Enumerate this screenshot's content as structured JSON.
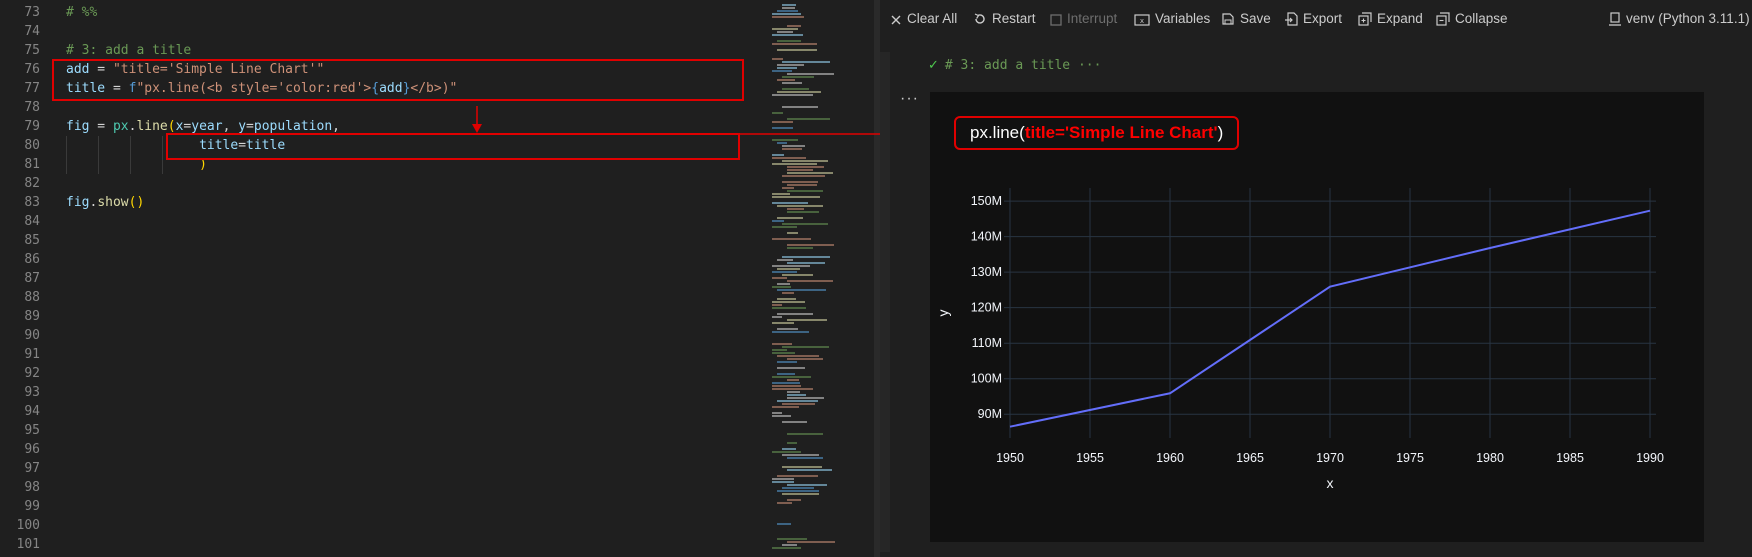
{
  "editor": {
    "lines": [
      {
        "num": "73",
        "tokens": [
          {
            "t": "# %%",
            "c": "comment"
          }
        ]
      },
      {
        "num": "74",
        "tokens": []
      },
      {
        "num": "75",
        "tokens": [
          {
            "t": "# 3: add a title",
            "c": "comment"
          }
        ]
      },
      {
        "num": "76",
        "tokens": [
          {
            "t": "add",
            "c": "var"
          },
          {
            "t": " = ",
            "c": "op"
          },
          {
            "t": "\"title='Simple Line Chart'\"",
            "c": "str"
          }
        ]
      },
      {
        "num": "77",
        "tokens": [
          {
            "t": "title",
            "c": "var"
          },
          {
            "t": " = ",
            "c": "op"
          },
          {
            "t": "f",
            "c": "kw"
          },
          {
            "t": "\"px.line(<b style='color:red'>",
            "c": "str"
          },
          {
            "t": "{",
            "c": "kw"
          },
          {
            "t": "add",
            "c": "var"
          },
          {
            "t": "}",
            "c": "kw"
          },
          {
            "t": "</b>)\"",
            "c": "str"
          }
        ]
      },
      {
        "num": "78",
        "tokens": []
      },
      {
        "num": "79",
        "tokens": [
          {
            "t": "fig",
            "c": "var"
          },
          {
            "t": " = ",
            "c": "op"
          },
          {
            "t": "px",
            "c": "ns"
          },
          {
            "t": ".",
            "c": "op"
          },
          {
            "t": "line",
            "c": "fn"
          },
          {
            "t": "(",
            "c": "br1"
          },
          {
            "t": "x",
            "c": "var"
          },
          {
            "t": "=",
            "c": "op"
          },
          {
            "t": "year",
            "c": "var"
          },
          {
            "t": ", ",
            "c": "op"
          },
          {
            "t": "y",
            "c": "var"
          },
          {
            "t": "=",
            "c": "op"
          },
          {
            "t": "population",
            "c": "var"
          },
          {
            "t": ",",
            "c": "op"
          }
        ]
      },
      {
        "num": "80",
        "tokens": [
          {
            "t": "                 ",
            "c": "op"
          },
          {
            "t": "title",
            "c": "var"
          },
          {
            "t": "=",
            "c": "op"
          },
          {
            "t": "title",
            "c": "var"
          }
        ]
      },
      {
        "num": "81",
        "tokens": [
          {
            "t": "                 ",
            "c": "op"
          },
          {
            "t": ")",
            "c": "br1"
          }
        ]
      },
      {
        "num": "82",
        "tokens": []
      },
      {
        "num": "83",
        "tokens": [
          {
            "t": "fig",
            "c": "var"
          },
          {
            "t": ".",
            "c": "op"
          },
          {
            "t": "show",
            "c": "fn"
          },
          {
            "t": "()",
            "c": "br1"
          }
        ]
      },
      {
        "num": "84",
        "tokens": []
      },
      {
        "num": "85",
        "tokens": []
      },
      {
        "num": "86",
        "tokens": []
      },
      {
        "num": "87",
        "tokens": []
      },
      {
        "num": "88",
        "tokens": []
      },
      {
        "num": "89",
        "tokens": []
      },
      {
        "num": "90",
        "tokens": []
      },
      {
        "num": "91",
        "tokens": []
      },
      {
        "num": "92",
        "tokens": []
      },
      {
        "num": "93",
        "tokens": []
      },
      {
        "num": "94",
        "tokens": []
      },
      {
        "num": "95",
        "tokens": []
      },
      {
        "num": "96",
        "tokens": []
      },
      {
        "num": "97",
        "tokens": []
      },
      {
        "num": "98",
        "tokens": []
      },
      {
        "num": "99",
        "tokens": []
      },
      {
        "num": "100",
        "tokens": []
      },
      {
        "num": "101",
        "tokens": []
      }
    ]
  },
  "toolbar": {
    "clear_all": "Clear All",
    "restart": "Restart",
    "interrupt": "Interrupt",
    "variables": "Variables",
    "save": "Save",
    "export": "Export",
    "expand": "Expand",
    "collapse": "Collapse",
    "kernel": "venv (Python 3.11.1)"
  },
  "cell": {
    "header": "# 3: add a title ···",
    "ellipsis": "···",
    "title_prefix": "px.line(",
    "title_bold": "title='Simple Line Chart'",
    "title_suffix": ")"
  },
  "colors": {
    "line": "#636efa",
    "grid": "#283442",
    "annotation": "#e00000",
    "plot_bg": "#111111"
  },
  "chart_data": {
    "type": "line",
    "title": "px.line(title='Simple Line Chart')",
    "xlabel": "x",
    "ylabel": "y",
    "x": [
      1950,
      1960,
      1970,
      1980,
      1990
    ],
    "y": [
      86.5,
      95.9,
      125.9,
      136.8,
      147.3
    ],
    "xlim": [
      1950,
      1990
    ],
    "ylim": [
      85,
      152
    ],
    "xticks": [
      1950,
      1955,
      1960,
      1965,
      1970,
      1975,
      1980,
      1985,
      1990
    ],
    "yticks": [
      90,
      100,
      110,
      120,
      130,
      140,
      150
    ],
    "ytick_labels": [
      "90M",
      "100M",
      "110M",
      "120M",
      "130M",
      "140M",
      "150M"
    ],
    "grid": true
  }
}
